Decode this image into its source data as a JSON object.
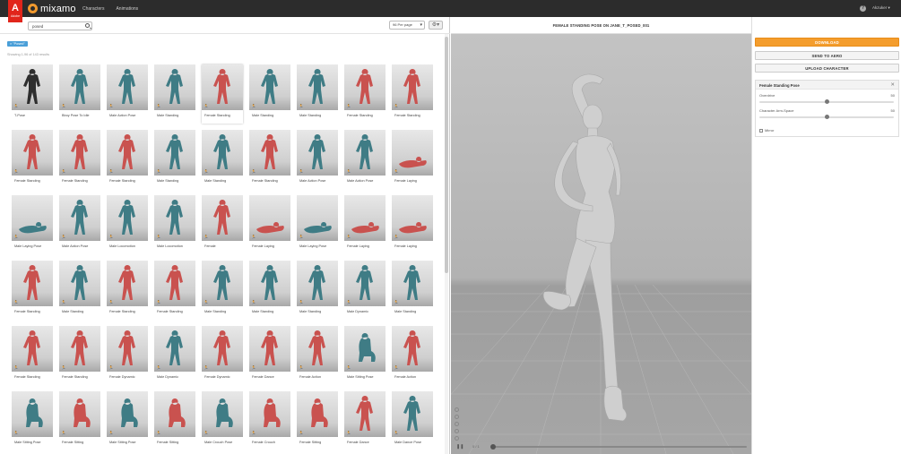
{
  "app": {
    "adobe_label": "Adobe",
    "brand_name": "mixamo",
    "nav": [
      "Characters",
      "Animations"
    ],
    "help_glyph": "?",
    "user_name": "Akzuker"
  },
  "search": {
    "value": "posed",
    "per_page": "96 Per page",
    "filter_tag": "× \"Posed\"",
    "results_info": "Showing 1-96 of 143 results"
  },
  "cards": [
    {
      "label": "T-Pose",
      "color": "dark"
    },
    {
      "label": "Bboy Pose To Idle",
      "color": "teal"
    },
    {
      "label": "Male Action Pose",
      "color": "teal"
    },
    {
      "label": "Male Standing",
      "color": "teal"
    },
    {
      "label": "Female Standing",
      "color": "red",
      "selected": true
    },
    {
      "label": "Male Standing",
      "color": "teal"
    },
    {
      "label": "Male Standing",
      "color": "teal"
    },
    {
      "label": "Female Standing",
      "color": "red"
    },
    {
      "label": "Female Standing",
      "color": "red"
    },
    {
      "label": "Female Standing",
      "color": "red"
    },
    {
      "label": "Female Standing",
      "color": "red"
    },
    {
      "label": "Female Standing",
      "color": "red"
    },
    {
      "label": "Male Standing",
      "color": "teal"
    },
    {
      "label": "Male Standing",
      "color": "teal"
    },
    {
      "label": "Female Standing",
      "color": "red"
    },
    {
      "label": "Male Action Pose",
      "color": "teal"
    },
    {
      "label": "Male Action Pose",
      "color": "teal"
    },
    {
      "label": "Female Laying",
      "color": "red"
    },
    {
      "label": "Male Laying Pose",
      "color": "teal"
    },
    {
      "label": "Male Action Pose",
      "color": "teal"
    },
    {
      "label": "Male Locomotion",
      "color": "teal"
    },
    {
      "label": "Male Locomotion",
      "color": "teal"
    },
    {
      "label": "Female",
      "color": "red"
    },
    {
      "label": "Female Laying",
      "color": "red"
    },
    {
      "label": "Male Laying Pose",
      "color": "teal"
    },
    {
      "label": "Female Laying",
      "color": "red"
    },
    {
      "label": "Female Laying",
      "color": "red"
    },
    {
      "label": "Female Standing",
      "color": "red"
    },
    {
      "label": "Male Standing",
      "color": "teal"
    },
    {
      "label": "Female Standing",
      "color": "red"
    },
    {
      "label": "Female Standing",
      "color": "red"
    },
    {
      "label": "Male Standing",
      "color": "teal"
    },
    {
      "label": "Male Standing",
      "color": "teal"
    },
    {
      "label": "Male Standing",
      "color": "teal"
    },
    {
      "label": "Male Dynamic",
      "color": "teal"
    },
    {
      "label": "Male Standing",
      "color": "teal"
    },
    {
      "label": "Female Standing",
      "color": "red"
    },
    {
      "label": "Female Standing",
      "color": "red"
    },
    {
      "label": "Female Dynamic",
      "color": "red"
    },
    {
      "label": "Male Dynamic",
      "color": "teal"
    },
    {
      "label": "Female Dynamic",
      "color": "red"
    },
    {
      "label": "Female Dance",
      "color": "red"
    },
    {
      "label": "Female Action",
      "color": "red"
    },
    {
      "label": "Male Sitting Pose",
      "color": "teal"
    },
    {
      "label": "Female Action",
      "color": "red"
    },
    {
      "label": "Male Sitting Pose",
      "color": "teal"
    },
    {
      "label": "Female Sitting",
      "color": "red"
    },
    {
      "label": "Male Sitting Pose",
      "color": "teal"
    },
    {
      "label": "Female Sitting",
      "color": "red"
    },
    {
      "label": "Male Crouch Pose",
      "color": "teal"
    },
    {
      "label": "Female Crouch",
      "color": "red"
    },
    {
      "label": "Female Sitting",
      "color": "red"
    },
    {
      "label": "Female Dance",
      "color": "red"
    },
    {
      "label": "Male Dance Pose",
      "color": "teal"
    }
  ],
  "viewer": {
    "title": "FEMALE STANDING POSE ON JANE_T_POSED_001",
    "frame_count": "0 / 1",
    "play_glyph": "❚❚"
  },
  "actions": {
    "download": "DOWNLOAD",
    "send_to_aero": "SEND TO AERO",
    "upload_character": "UPLOAD CHARACTER"
  },
  "pose_panel": {
    "title": "Female Standing Pose",
    "params": [
      {
        "label": "Overdrive",
        "value": "50",
        "level": 0.5
      },
      {
        "label": "Character Arm-Space",
        "value": "50",
        "level": 0.5
      }
    ],
    "mirror_label": "Mirror"
  },
  "colors": {
    "accent": "#f49d2d",
    "red_figure": "#c9524f",
    "teal_figure": "#3f7c85",
    "dark_figure": "#2e2e2e",
    "tag": "#4a9fd8"
  }
}
